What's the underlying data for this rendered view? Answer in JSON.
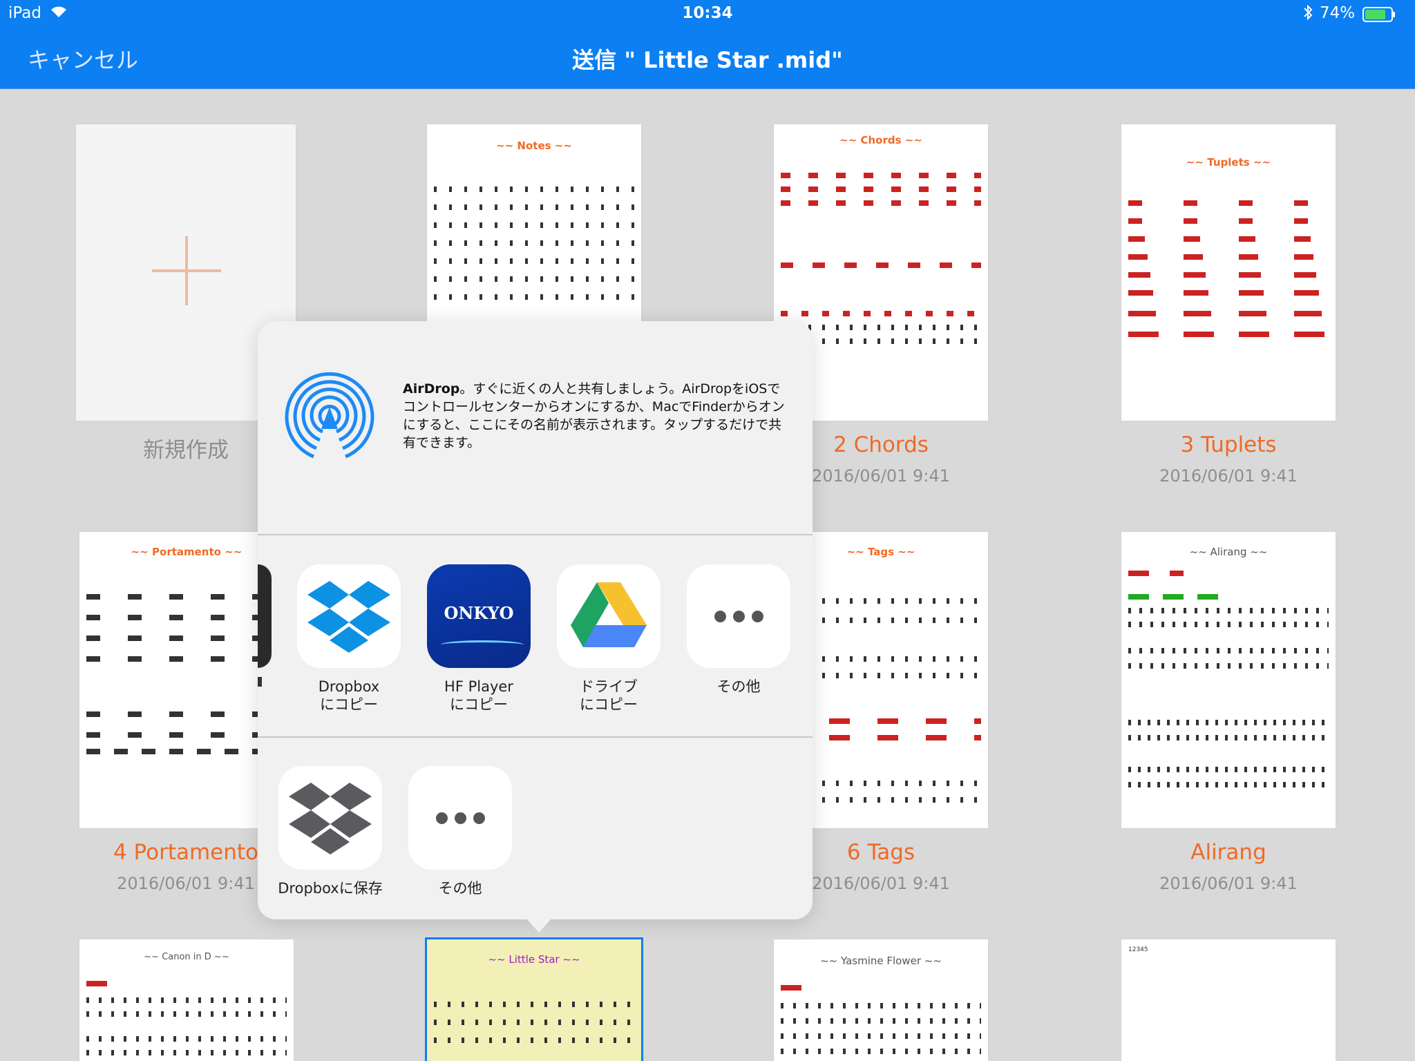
{
  "status": {
    "device": "iPad",
    "time": "10:34",
    "battery_percent": "74%"
  },
  "nav": {
    "cancel_label": "キャンセル",
    "title": "送信 \" Little Star .mid\""
  },
  "items": [
    {
      "thumb_title": "",
      "label": "新規作成",
      "date": ""
    },
    {
      "thumb_title": "~~ Notes ~~",
      "label": "",
      "date": ""
    },
    {
      "thumb_title": "~~ Chords ~~",
      "label": "2 Chords",
      "date": "2016/06/01 9:41"
    },
    {
      "thumb_title": "~~ Tuplets ~~",
      "label": "3 Tuplets",
      "date": "2016/06/01 9:41"
    },
    {
      "thumb_title": "~~ Portamento ~~",
      "label": "4 Portamento",
      "date": "2016/06/01 9:41"
    },
    {
      "thumb_title": "",
      "label": "",
      "date": ""
    },
    {
      "thumb_title": "~~ Tags ~~",
      "label": "6 Tags",
      "date": "2016/06/01 9:41"
    },
    {
      "thumb_title": "~~ Alirang ~~",
      "label": "Alirang",
      "date": "2016/06/01 9:41"
    },
    {
      "thumb_title": "~~ Canon in D ~~",
      "label": "",
      "date": ""
    },
    {
      "thumb_title": "~~ Little Star ~~",
      "label": "",
      "date": ""
    },
    {
      "thumb_title": "~~ Yasmine Flower ~~",
      "label": "",
      "date": ""
    },
    {
      "thumb_title": "12345",
      "label": "",
      "date": ""
    }
  ],
  "airdrop": {
    "title": "AirDrop",
    "text": "。すぐに近くの人と共有しましょう。AirDropをiOSでコントロールセンターからオンにするか、MacでFinderからオンにすると、ここにその名前が表示されます。タップするだけで共有できます。"
  },
  "share_apps": [
    {
      "line1": "Dropbox",
      "line2": "にコピー",
      "icon": "dropbox-icon"
    },
    {
      "line1": "HF Player",
      "line2": "にコピー",
      "icon": "onkyo-icon",
      "brand_text": "ONKYO"
    },
    {
      "line1": "ドライブ",
      "line2": "にコピー",
      "icon": "google-drive-icon"
    },
    {
      "line1": "その他",
      "line2": "",
      "icon": "more-icon"
    }
  ],
  "actions": [
    {
      "label": "Dropboxに保存",
      "icon": "dropbox-gray-icon"
    },
    {
      "label": "その他",
      "icon": "more-icon"
    }
  ],
  "colors": {
    "accent": "#0c7ff2",
    "orange": "#ef6a25",
    "sheet_bg": "#f1f1f1",
    "selected_fill": "#f2efb7"
  }
}
